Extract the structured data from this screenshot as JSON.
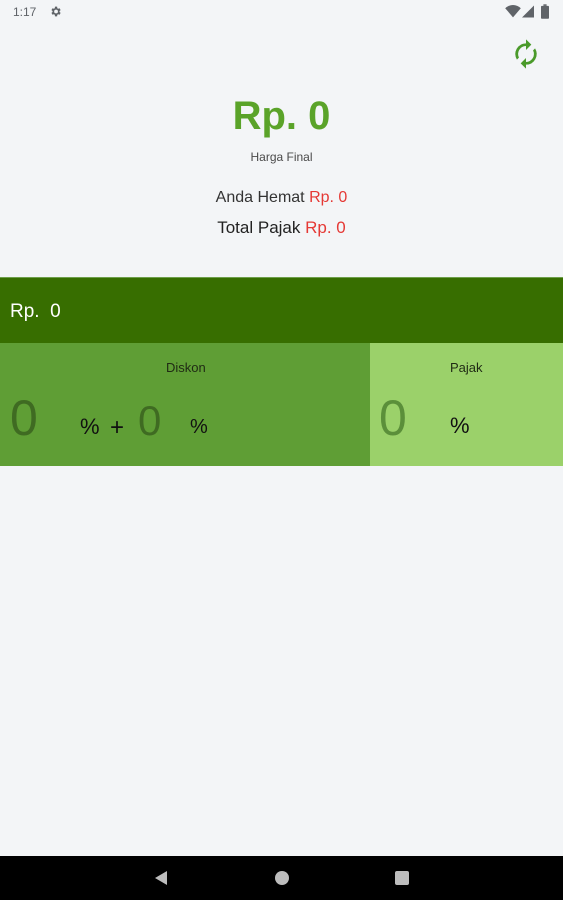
{
  "status_bar": {
    "time": "1:17",
    "icons": [
      "settings-icon",
      "wifi-icon",
      "signal-icon",
      "battery-icon"
    ]
  },
  "header": {
    "refresh_icon": "refresh-icon",
    "final_price": "Rp. 0",
    "final_label": "Harga Final",
    "savings_label": "Anda Hemat",
    "savings_value": "Rp. 0",
    "tax_label": "Total Pajak",
    "tax_value": "Rp. 0"
  },
  "price_input": {
    "value": "Rp.  0"
  },
  "discount": {
    "label": "Diskon",
    "value1": "0",
    "percent1": "%",
    "plus": "+",
    "value2": "0",
    "percent2": "%"
  },
  "tax": {
    "label": "Pajak",
    "value": "0",
    "percent": "%"
  },
  "nav_bar": {
    "icons": [
      "back-icon",
      "home-icon",
      "recents-icon"
    ]
  },
  "colors": {
    "accent": "#5aa329",
    "dark_green": "#376e00",
    "mid_green": "#5f9e35",
    "light_green": "#9bd16a",
    "red": "#e53935"
  }
}
